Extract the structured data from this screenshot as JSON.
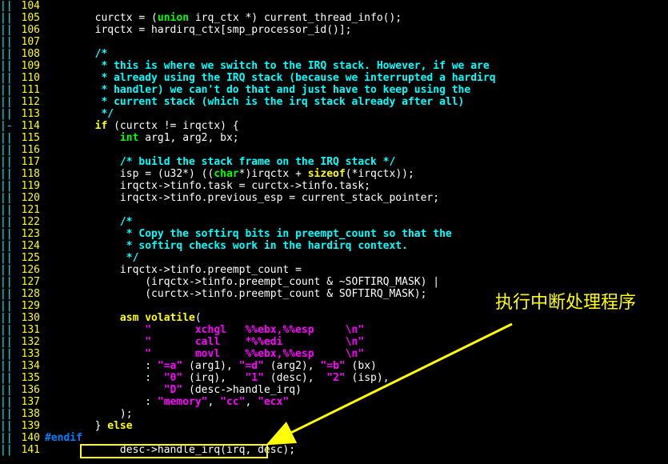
{
  "annotation": {
    "text": "执行中断处理程序"
  },
  "lines": [
    {
      "n": "104",
      "g": "||",
      "code": ""
    },
    {
      "n": "105",
      "g": "||",
      "code": "        curctx = (<t>union</t> irq_ctx *) current_thread_info();"
    },
    {
      "n": "106",
      "g": "||",
      "code": "        irqctx = hardirq_ctx[smp_processor_id()];"
    },
    {
      "n": "107",
      "g": "||",
      "code": ""
    },
    {
      "n": "108",
      "g": "||",
      "code": "        <c>/*</c>"
    },
    {
      "n": "109",
      "g": "||",
      "code": "<c>         * this is where we switch to the IRQ stack. However, if we are</c>"
    },
    {
      "n": "110",
      "g": "||",
      "code": "<c>         * already using the IRQ stack (because we interrupted a hardirq</c>"
    },
    {
      "n": "111",
      "g": "||",
      "code": "<c>         * handler) we can't do that and just have to keep using the</c>"
    },
    {
      "n": "112",
      "g": "||",
      "code": "<c>         * current stack (which is the irq stack already after all)</c>"
    },
    {
      "n": "113",
      "g": "||",
      "code": "<c>         */</c>"
    },
    {
      "n": "114",
      "g": "|-",
      "code": "        <k>if</k> (curctx != irqctx) {"
    },
    {
      "n": "115",
      "g": "||",
      "code": "            <t>int</t> arg1, arg2, bx;"
    },
    {
      "n": "116",
      "g": "||",
      "code": ""
    },
    {
      "n": "117",
      "g": "||",
      "code": "            <c>/* build the stack frame on the IRQ stack */</c>"
    },
    {
      "n": "118",
      "g": "||",
      "code": "            isp = (u32*) ((<t>char</t>*)irqctx + <k>sizeof</k>(*irqctx));"
    },
    {
      "n": "119",
      "g": "||",
      "code": "            irqctx->tinfo.task = curctx->tinfo.task;"
    },
    {
      "n": "120",
      "g": "||",
      "code": "            irqctx->tinfo.previous_esp = current_stack_pointer;"
    },
    {
      "n": "121",
      "g": "||",
      "code": ""
    },
    {
      "n": "122",
      "g": "||",
      "code": "            <c>/*</c>"
    },
    {
      "n": "123",
      "g": "||",
      "code": "<c>             * Copy the softirq bits in preempt_count so that the</c>"
    },
    {
      "n": "124",
      "g": "||",
      "code": "<c>             * softirq checks work in the hardirq context.</c>"
    },
    {
      "n": "125",
      "g": "||",
      "code": "<c>             */</c>"
    },
    {
      "n": "126",
      "g": "||",
      "code": "            irqctx->tinfo.preempt_count ="
    },
    {
      "n": "127",
      "g": "||",
      "code": "                (irqctx->tinfo.preempt_count & ~SOFTIRQ_MASK) |"
    },
    {
      "n": "128",
      "g": "||",
      "code": "                (curctx->tinfo.preempt_count & SOFTIRQ_MASK);"
    },
    {
      "n": "129",
      "g": "||",
      "code": ""
    },
    {
      "n": "130",
      "g": "||",
      "code": "            <k>asm</k> <k>volatile</k>("
    },
    {
      "n": "131",
      "g": "||",
      "code": "                <s>\"       xchgl   %%ebx,%%esp     </s><num>\\n</num><s>\"</s>"
    },
    {
      "n": "132",
      "g": "||",
      "code": "                <s>\"       call    *%%edi          </s><num>\\n</num><s>\"</s>"
    },
    {
      "n": "133",
      "g": "||",
      "code": "                <s>\"       movl    %%ebx,%%esp     </s><num>\\n</num><s>\"</s>"
    },
    {
      "n": "134",
      "g": "||",
      "code": "                : <s>\"=a\"</s> (arg1), <s>\"=d\"</s> (arg2), <s>\"=b\"</s> (bx)"
    },
    {
      "n": "135",
      "g": "||",
      "code": "                :  <s>\"0\"</s> (irq),   <s>\"1\"</s> (desc),  <s>\"2\"</s> (isp),"
    },
    {
      "n": "136",
      "g": "||",
      "code": "                   <s>\"D\"</s> (desc->handle_irq)"
    },
    {
      "n": "137",
      "g": "||",
      "code": "                : <s>\"memory\"</s>, <s>\"cc\"</s>, <s>\"ecx\"</s>"
    },
    {
      "n": "138",
      "g": "||",
      "code": "            );"
    },
    {
      "n": "139",
      "g": "||",
      "code": "        } <k>else</k>"
    },
    {
      "n": "140",
      "g": "||",
      "code": "<p>#endif</p>"
    },
    {
      "n": "141",
      "g": "||",
      "code": "            desc->handle_irq(irq, desc);"
    }
  ]
}
